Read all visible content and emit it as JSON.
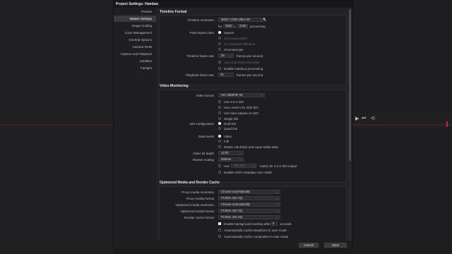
{
  "window": {
    "title": "Project Settings:  Hambac"
  },
  "background": {
    "transport_icons": [
      "play-icon",
      "skip-end-icon",
      "loop-icon"
    ]
  },
  "sidebar": {
    "items": [
      {
        "label": "Presets"
      },
      {
        "label": "Master Settings",
        "active": true
      },
      {
        "label": "Image Scaling"
      },
      {
        "label": "Color Management"
      },
      {
        "label": "General Options"
      },
      {
        "label": "Camera RAW"
      },
      {
        "label": "Capture and Playback"
      },
      {
        "label": "Subtitles"
      },
      {
        "label": "Fairlight"
      }
    ]
  },
  "timeline_format": {
    "title": "Timeline Format",
    "resolution_label": "Timeline resolution",
    "resolution_value": "3840 x 2160 Ultra HD",
    "for_label": "for",
    "width": "3840",
    "x_label": "x",
    "height": "2160",
    "processing_label": "processing",
    "pixel_aspect_label": "Pixel aspect ratio",
    "aspect_options": [
      {
        "label": "Square",
        "selected": true,
        "enabled": true
      },
      {
        "label": "16:9 anamorphic",
        "selected": false,
        "enabled": false
      },
      {
        "label": "4:3 standard definition",
        "selected": false,
        "enabled": false
      },
      {
        "label": "Cinemascope",
        "selected": false,
        "enabled": true
      }
    ],
    "frame_rate_label": "Timeline frame rate",
    "frame_rate_value": "25",
    "frames_per_second": "frames per second",
    "drop_frame_label": "Use drop frame timecode",
    "interlace_label": "Enable interlace processing",
    "playback_rate_label": "Playback frame rate",
    "playback_rate_value": "25",
    "playback_fps": "frames per second"
  },
  "video_monitoring": {
    "title": "Video Monitoring",
    "format_label": "Video format",
    "format_value": "HD 1080PsF 25",
    "checks": [
      {
        "label": "Use 4:4:4 SDI"
      },
      {
        "label": "Use Level A for 3Gb SDI"
      },
      {
        "label": "Use dual outputs on SDI"
      }
    ],
    "sdi_label": "SDI configuration",
    "sdi_options": [
      {
        "label": "Single link",
        "selected": false
      },
      {
        "label": "Dual link",
        "selected": true
      },
      {
        "label": "Quad link",
        "selected": false
      }
    ],
    "data_levels_label": "Data levels",
    "data_levels_options": [
      {
        "label": "Video",
        "selected": true
      },
      {
        "label": "Full",
        "selected": false
      }
    ],
    "retain_label": "Retain sub-black and super-white data",
    "bit_depth_label": "Video bit depth",
    "bit_depth_value": "10 bit",
    "scaling_label": "Monitor scaling",
    "scaling_value": "Bilinear",
    "use_label": "Use",
    "rec_value": "Rec.601",
    "matrix_label": "matrix for 4:2:2 SDI output",
    "hdr_label": "Enable HDR metadata over HDMI"
  },
  "optimized_media": {
    "title": "Optimized Media and Render Cache",
    "rows": [
      {
        "label": "Proxy media resolution",
        "value": "Choose automatically"
      },
      {
        "label": "Proxy media format",
        "value": "ProRes 422 HQ"
      },
      {
        "label": "Optimized media resolution",
        "value": "Choose automatically"
      },
      {
        "label": "Optimized media format",
        "value": "ProRes 422 HQ"
      },
      {
        "label": "Render cache format",
        "value": "ProRes 422 HQ"
      }
    ],
    "bg_cache_label": "Enable background caching after",
    "bg_cache_value": "5",
    "seconds_label": "seconds",
    "auto_transitions_label": "Automatically cache transitions in user mode",
    "auto_composites_label": "Automatically cache composites in user mode"
  },
  "footer": {
    "cancel": "Cancel",
    "save": "Save"
  }
}
